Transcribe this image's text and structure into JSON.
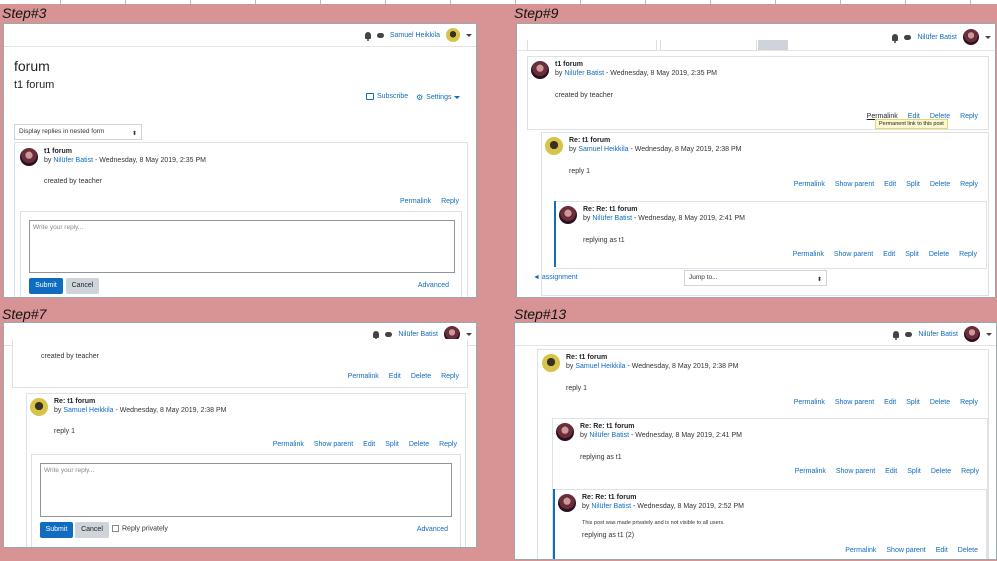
{
  "steps": {
    "s3": "Step#3",
    "s7": "Step#7",
    "s9": "Step#9",
    "s13": "Step#13"
  },
  "users": {
    "samuel": "Samuel Heikkila",
    "nilufer": "Nilüfer Batist"
  },
  "p3": {
    "page_title": "forum",
    "discussion_title": "t1 forum",
    "subscribe": "Subscribe",
    "settings": "Settings",
    "display_mode": "Display replies in nested form",
    "post": {
      "title": "t1 forum",
      "by": "by",
      "author": "Nilüfer Batist",
      "date": " - Wednesday, 8 May 2019, 2:35 PM",
      "body": "created by teacher"
    },
    "permalink": "Permalink",
    "reply": "Reply",
    "reply_placeholder": "Write your reply...",
    "submit": "Submit",
    "cancel": "Cancel",
    "advanced": "Advanced"
  },
  "p7": {
    "top_body": "created by teacher",
    "a1": {
      "permalink": "Permalink",
      "edit": "Edit",
      "delete": "Delete",
      "reply": "Reply"
    },
    "post": {
      "title": "Re: t1 forum",
      "by": "by",
      "author": "Samuel Heikkila",
      "date": " - Wednesday, 8 May 2019, 2:38 PM",
      "body": "reply 1"
    },
    "a2": {
      "permalink": "Permalink",
      "show_parent": "Show parent",
      "edit": "Edit",
      "split": "Split",
      "delete": "Delete",
      "reply": "Reply"
    },
    "reply_placeholder": "Write your reply...",
    "submit": "Submit",
    "cancel": "Cancel",
    "reply_privately": "Reply privately",
    "advanced": "Advanced"
  },
  "p9": {
    "post1": {
      "title": "t1 forum",
      "by": "by",
      "author": "Nilüfer Batist",
      "date": " - Wednesday, 8 May 2019, 2:35 PM",
      "body": "created by teacher"
    },
    "a1": {
      "permalink": "Permalink",
      "edit": "Edit",
      "delete": "Delete",
      "reply": "Reply"
    },
    "tooltip": "Permanent link to this post",
    "post2": {
      "title": "Re: t1 forum",
      "by": "by",
      "author": "Samuel Heikkila",
      "date": " - Wednesday, 8 May 2019, 2:38 PM",
      "body": "reply 1"
    },
    "a2": {
      "permalink": "Permalink",
      "show_parent": "Show parent",
      "edit": "Edit",
      "split": "Split",
      "delete": "Delete",
      "reply": "Reply"
    },
    "post3": {
      "title": "Re: Re: t1 forum",
      "by": "by",
      "author": "Nilüfer Batist",
      "date": " - Wednesday, 8 May 2019, 2:41 PM",
      "body": "replying as t1"
    },
    "a3": {
      "permalink": "Permalink",
      "show_parent": "Show parent",
      "edit": "Edit",
      "split": "Split",
      "delete": "Delete",
      "reply": "Reply"
    },
    "prev_link": "◄ assignment",
    "jump_to": "Jump to..."
  },
  "p13": {
    "post1": {
      "title": "Re: t1 forum",
      "by": "by",
      "author": "Samuel Heikkila",
      "date": " - Wednesday, 8 May 2019, 2:38 PM",
      "body": "reply 1"
    },
    "a1": {
      "permalink": "Permalink",
      "show_parent": "Show parent",
      "edit": "Edit",
      "split": "Split",
      "delete": "Delete",
      "reply": "Reply"
    },
    "post2": {
      "title": "Re: Re: t1 forum",
      "by": "by",
      "author": "Nilüfer Batist",
      "date": " - Wednesday, 8 May 2019, 2:41 PM",
      "body": "replying as t1"
    },
    "a2": {
      "permalink": "Permalink",
      "show_parent": "Show parent",
      "edit": "Edit",
      "split": "Split",
      "delete": "Delete",
      "reply": "Reply"
    },
    "post3": {
      "title": "Re: Re: t1 forum",
      "by": "by",
      "author": "Nilüfer Batist",
      "date": " - Wednesday, 8 May 2019, 2:52 PM",
      "notice": "This post was made privately and is not visible to all users.",
      "body": "replying as t1 (2)"
    },
    "a3": {
      "permalink": "Permalink",
      "show_parent": "Show parent",
      "edit": "Edit",
      "delete": "Delete"
    }
  },
  "colors": {
    "background": "#d89494",
    "link": "#0f6cbf",
    "primary": "#0f6cbf"
  }
}
